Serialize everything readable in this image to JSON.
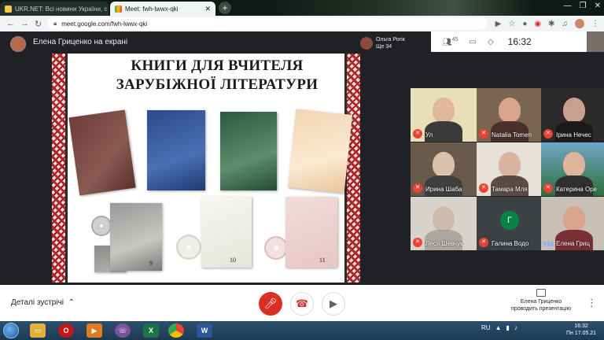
{
  "browser": {
    "tabs": [
      {
        "label": "UKR.NET: Всі новини України, с",
        "active": false
      },
      {
        "label": "Meet: fwh-lwwx-qki",
        "active": true
      }
    ],
    "new_tab_icon": "+",
    "address": "meet.google.com/fwh-lwwx-qki",
    "window_controls": [
      "—",
      "❐",
      "✕"
    ]
  },
  "meet": {
    "presenter_banner": "Елена Гриценко на екрані",
    "pinned_user": {
      "name": "Ольга Рогік",
      "status": "Ще 34"
    },
    "participants_count": "45",
    "clock": "16:32",
    "slide": {
      "title_line1": "КНИГИ ДЛЯ ВЧИТЕЛЯ",
      "title_line2": "ЗАРУБІЖНОЇ ЛІТЕРАТУРИ",
      "grades": [
        "9",
        "10",
        "11"
      ]
    },
    "participants": [
      {
        "name": "Ул"
      },
      {
        "name": "Natalia Tomen"
      },
      {
        "name": "Ірина Нечес"
      },
      {
        "name": "Ирина Шаба"
      },
      {
        "name": "Тамара Мля"
      },
      {
        "name": "Катерина Оре"
      },
      {
        "name": "Леся Шевчук"
      },
      {
        "name": "Галина Водо",
        "initial": "Г"
      },
      {
        "name": "Елена Гриц"
      }
    ],
    "bottom": {
      "details_label": "Деталі зустрічі",
      "presenting_line1": "Елена Гриценко",
      "presenting_line2": "проводить презентацію"
    }
  },
  "taskbar": {
    "language": "RU",
    "time": "16:32",
    "date": "Пн 17.05.21"
  }
}
